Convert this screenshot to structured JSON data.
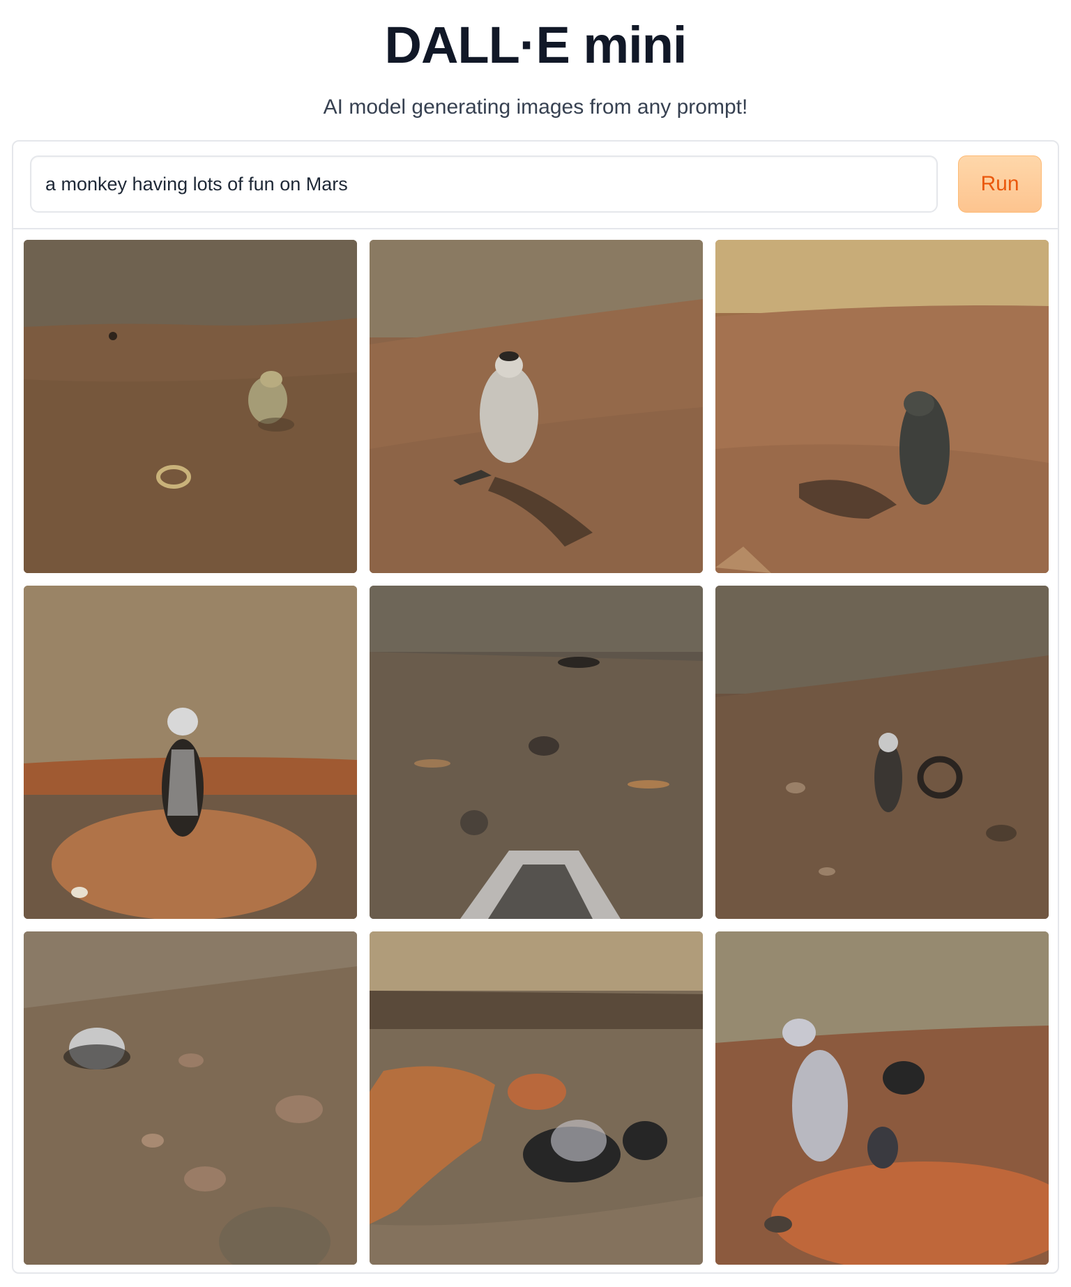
{
  "header": {
    "title": "DALL·E mini",
    "subtitle": "AI model generating images from any prompt!"
  },
  "prompt": {
    "value": "a monkey having lots of fun on Mars"
  },
  "run_button": {
    "label": "Run"
  },
  "gallery": {
    "images": [
      {
        "sky": "#6f6250",
        "ground": "#7a5a3e",
        "subject": "#9a9272"
      },
      {
        "sky": "#8a7a62",
        "ground": "#8a6448",
        "subject": "#c8c4bc"
      },
      {
        "sky": "#c8ac78",
        "ground": "#9c6e48",
        "subject": "#3e403c"
      },
      {
        "sky": "#9a8466",
        "ground": "#7a5e46",
        "subject": "#d8d8d8"
      },
      {
        "sky": "#6e6658",
        "ground": "#5e554a",
        "subject": "#e0e0e0"
      },
      {
        "sky": "#6e6454",
        "ground": "#6a5240",
        "subject": "#3a3632"
      },
      {
        "sky": "#8a7a66",
        "ground": "#7a6652",
        "subject": "#c8c8c8"
      },
      {
        "sky": "#b09c7a",
        "ground": "#7a6a56",
        "subject": "#262626"
      },
      {
        "sky": "#968a70",
        "ground": "#8a6a52",
        "subject": "#b8b8c0"
      }
    ]
  }
}
